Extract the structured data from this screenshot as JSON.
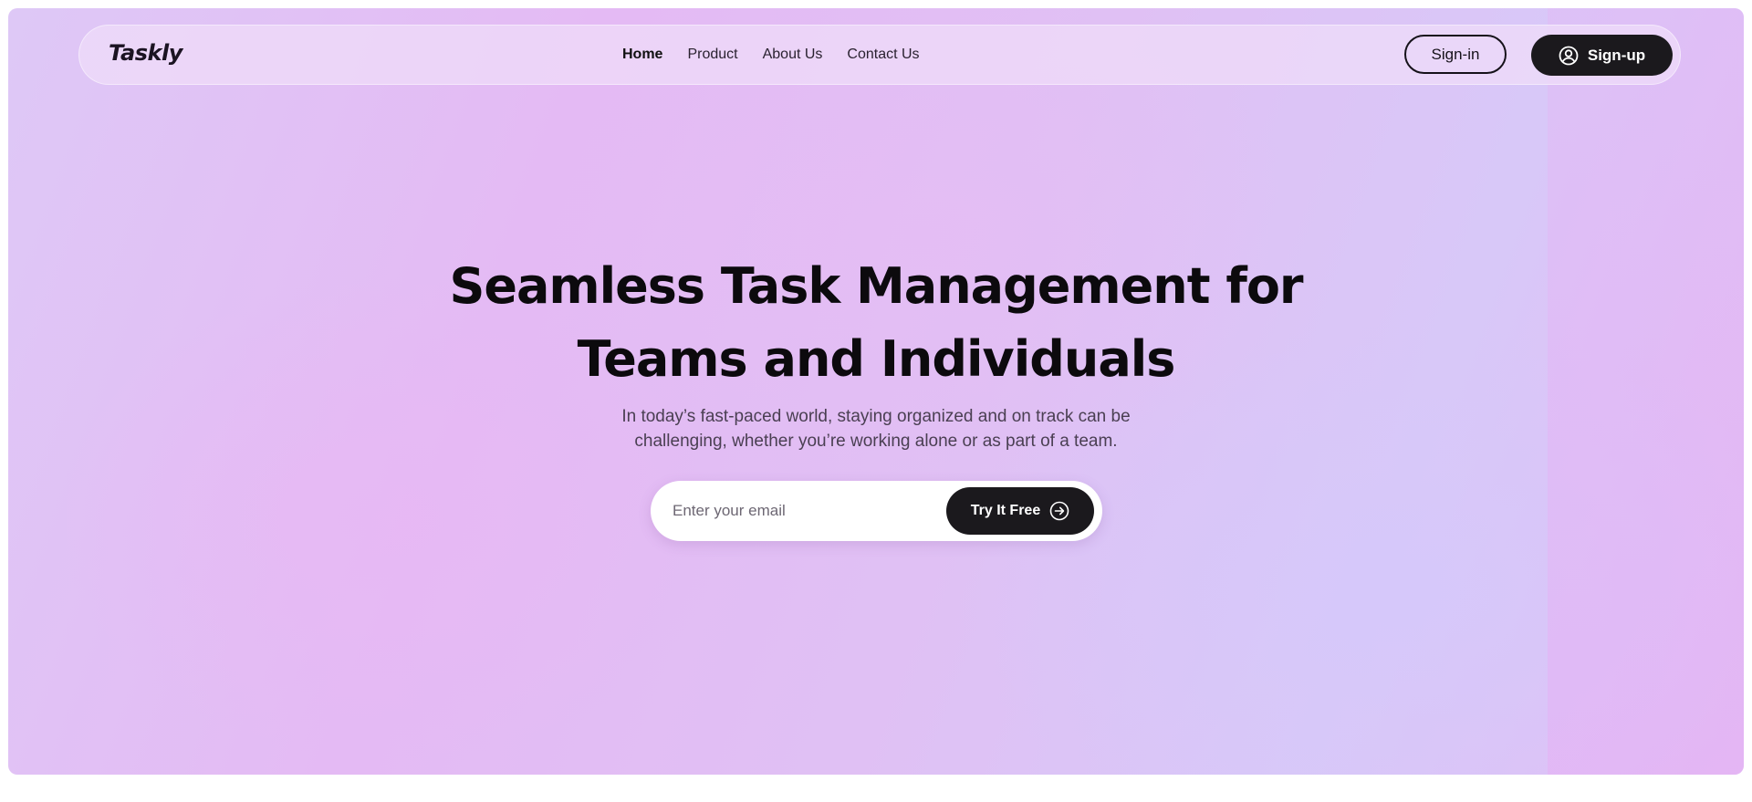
{
  "brand": {
    "logo_text": "Taskly"
  },
  "nav": {
    "links": [
      {
        "label": "Home",
        "active": true
      },
      {
        "label": "Product",
        "active": false
      },
      {
        "label": "About Us",
        "active": false
      },
      {
        "label": "Contact Us",
        "active": false
      }
    ],
    "signin_label": "Sign-in",
    "signup_label": "Sign-up",
    "signup_icon": "user-circle-icon"
  },
  "hero": {
    "title_line1": "Seamless Task Management for",
    "title_line2": "Teams and Individuals",
    "subtitle_line1": "In today’s fast-paced world, staying organized and on track can be",
    "subtitle_line2": "challenging, whether you’re working alone or as part of a team.",
    "email_placeholder": "Enter your email",
    "cta_label": "Try It Free",
    "cta_icon": "arrow-right-circle-icon"
  },
  "colors": {
    "button_dark": "#1b191d",
    "text_dark": "#0c0a0d",
    "background_lavender": "#e0c0f4"
  }
}
